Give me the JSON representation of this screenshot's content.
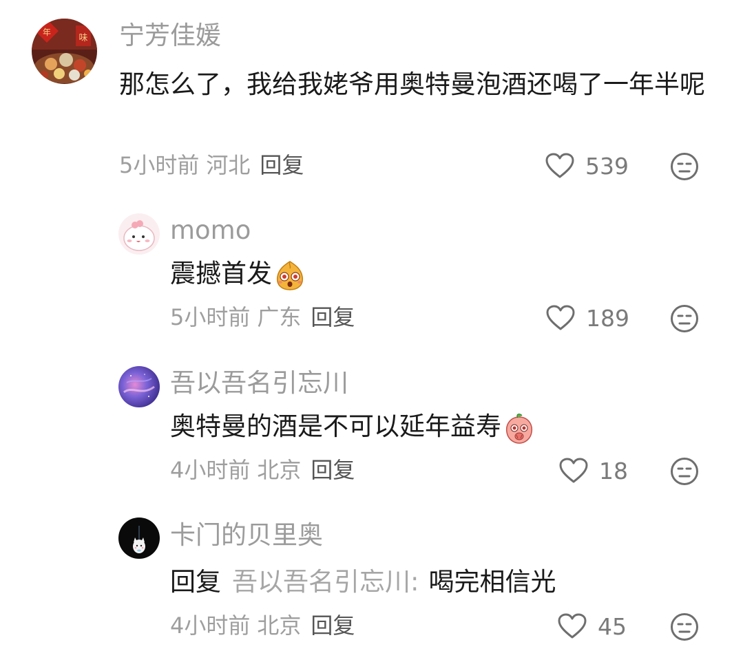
{
  "comments": [
    {
      "username": "宁芳佳媛",
      "avatar_icon": "new-year-feast-avatar",
      "avatar_text": [
        "年",
        "味"
      ],
      "text": "那怎么了，我给我姥爷用奥特曼泡酒还喝了一年半呢",
      "time": "5小时前",
      "location": "河北",
      "reply_label": "回复",
      "likes": "539"
    },
    {
      "username": "momo",
      "avatar_icon": "cute-pink-creature-avatar",
      "text": "震撼首发",
      "emoji": "shocked-face-emoji",
      "time": "5小时前",
      "location": "广东",
      "reply_label": "回复",
      "likes": "189"
    },
    {
      "username": "吾以吾名引忘川",
      "avatar_icon": "purple-nebula-avatar",
      "text": "奥特曼的酒是不可以延年益寿",
      "emoji": "peach-shy-emoji",
      "time": "4小时前",
      "location": "北京",
      "reply_label": "回复",
      "likes": "18"
    },
    {
      "username": "卡门的贝里奥",
      "avatar_icon": "white-cat-black-avatar",
      "reply_prefix": "回复",
      "reply_target": "吾以吾名引忘川",
      "reply_colon": ":",
      "text": "喝完相信光",
      "time": "4小时前",
      "location": "北京",
      "reply_label": "回复",
      "likes": "45"
    }
  ],
  "colors": {
    "username": "#9b9b9b",
    "text": "#1a1a1a",
    "meta": "#9e9e9e",
    "reply_link": "#555555",
    "icon": "#6e6e6e"
  }
}
